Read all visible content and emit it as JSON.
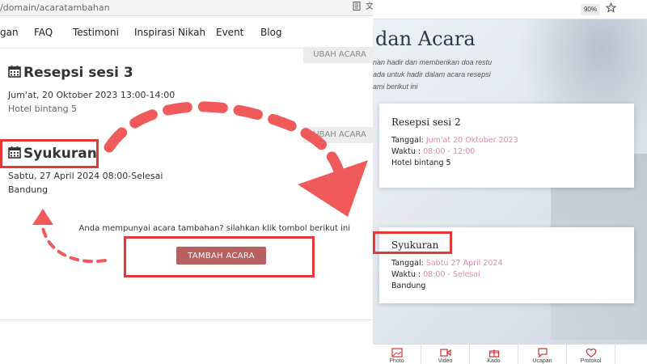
{
  "admin": {
    "url": "/domain/acaratambahan",
    "nav": [
      "gan",
      "FAQ",
      "Testimoni",
      "Inspirasi Nikah",
      "Event",
      "Blog"
    ],
    "edit_label": "UBAH ACARA",
    "events": [
      {
        "title": "Resepsi sesi 3",
        "datetime": "Jum'at, 20 Oktober 2023 13:00-14:00",
        "place": "Hotel bintang 5"
      },
      {
        "title": "Syukuran",
        "datetime": "Sabtu, 27 April 2024 08:00-Selesai",
        "place": "Bandung"
      }
    ],
    "extra_prompt": "Anda mempunyai acara tambahan? silahkan klik tombol berikut ini",
    "add_label": "TAMBAH ACARA"
  },
  "preview": {
    "zoom": "90%",
    "section_title": "dan Acara",
    "desc_lines": [
      "nan hadir dan memberikan doa restu",
      "ada untuk hadir dalam acara resepsi",
      "ami berikut ini"
    ],
    "cards": [
      {
        "title": "Resepsi sesi 2",
        "date_label": "Tanggal:",
        "date": "Jum'at 20 Oktober 2023",
        "time_label": "Waktu :",
        "time": "08:00 - 12:00",
        "place": "Hotel bintang 5"
      },
      {
        "title": "Syukuran",
        "date_label": "Tanggal:",
        "date": "Sabtu 27 April 2024",
        "time_label": "Waktu :",
        "time": "08:00 - Selesai",
        "place": "Bandung"
      }
    ],
    "bottom_nav": [
      "Photo",
      "Video",
      "Kado",
      "Ucapan",
      "Protokol"
    ]
  },
  "colors": {
    "annotation": "#e53935",
    "button": "#b85f60",
    "accent_pink": "#e08aa0"
  }
}
